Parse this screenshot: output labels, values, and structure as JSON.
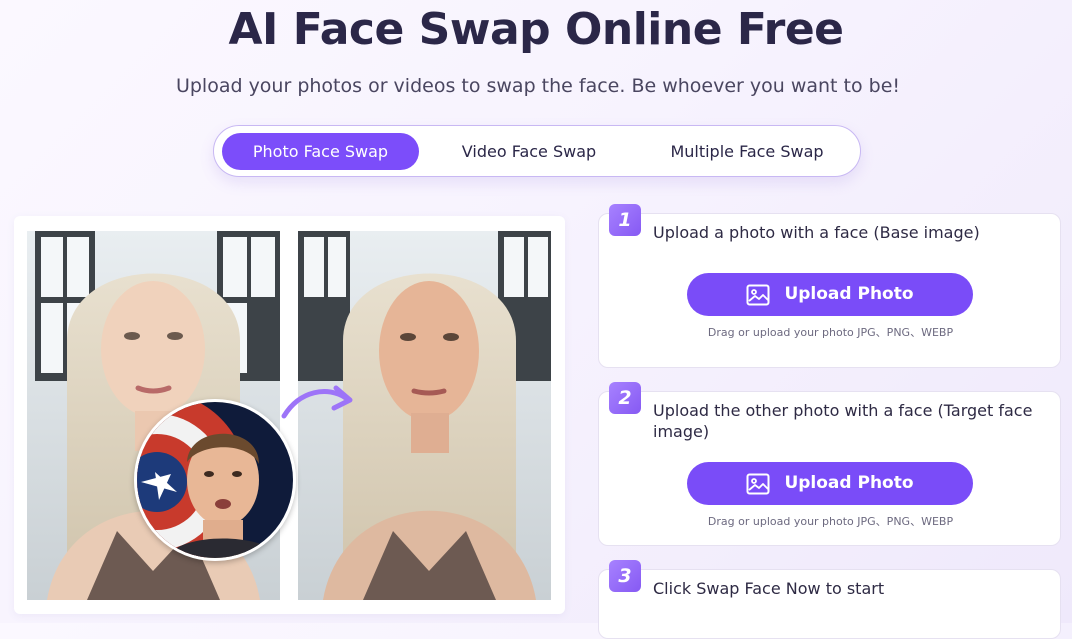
{
  "hero": {
    "title": "AI Face Swap Online Free",
    "subtitle": "Upload your photos or videos to swap the face. Be whoever you want to be!"
  },
  "tabs": [
    {
      "label": "Photo Face Swap",
      "active": true
    },
    {
      "label": "Video Face Swap",
      "active": false
    },
    {
      "label": "Multiple Face Swap",
      "active": false
    }
  ],
  "demo": {
    "icons": [
      "before-photo",
      "after-photo",
      "inset-face-photo",
      "swap-arrow-icon"
    ]
  },
  "steps": [
    {
      "number": "1",
      "text": "Upload a photo with a face (Base image)",
      "button_label": "Upload Photo",
      "hint": "Drag or upload your photo JPG、PNG、WEBP"
    },
    {
      "number": "2",
      "text": "Upload the other photo with a face (Target face image)",
      "button_label": "Upload Photo",
      "hint": "Drag or upload your photo JPG、PNG、WEBP"
    },
    {
      "number": "3",
      "text": "Click Swap Face Now to start"
    }
  ],
  "colors": {
    "accent": "#7c4dfa",
    "title": "#2b2748",
    "tab_border": "#c8b8f3"
  }
}
